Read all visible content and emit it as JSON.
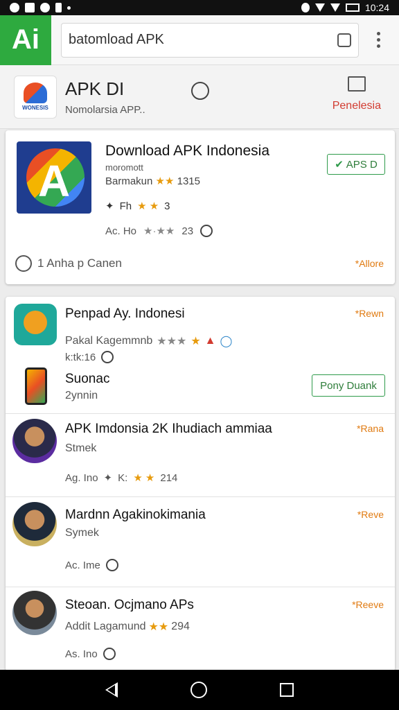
{
  "status_bar": {
    "time": "10:24"
  },
  "top_bar": {
    "logo_text": "Ai",
    "search_value": "batomload APK"
  },
  "app_header": {
    "logo_label": "WONESIS",
    "title": "APK DI",
    "subtitle": "Nomolarsia APP..",
    "right_label": "Penelesia"
  },
  "featured": {
    "title": "Download APK Indonesia",
    "developer": "moromott",
    "rating_text": "Barmakun",
    "rating_count": "1315",
    "row2_label": "Fh",
    "row2_count": "3",
    "row3_label": "Ac. Ho",
    "row3_num": "23",
    "button_label": "APS D",
    "footer_text": "1 Anha p Canen",
    "more_label": "*Allore"
  },
  "list": [
    {
      "title": "Penpad Ay. Indonesi",
      "sub": "Pakal Kagemmnb",
      "meta": "k:tk:16",
      "right": "*Rewn"
    },
    {
      "title": "Suonac",
      "sub": "2ynnin",
      "button": "Pony Duank"
    },
    {
      "title": "APK Imdonsia 2K Ihudiach ammiaa",
      "sub": "Stmek",
      "meta_label": "Ag. Ino",
      "meta_k": "K:",
      "meta_count": "214",
      "right": "*Rana"
    },
    {
      "title": "Mardnn Agakinokimania",
      "sub": "Symek",
      "meta_label": "Ac. Ime",
      "right": "*Reve"
    },
    {
      "title": "Steoan. Ocjmano APs",
      "sub": "Addit Lagamund",
      "meta_count": "294",
      "meta_label": "As. Ino",
      "right": "*Reeve"
    }
  ],
  "colors": {
    "brand_green": "#2eaa3f",
    "accent_orange": "#e07a10",
    "header_red": "#d23b30"
  }
}
